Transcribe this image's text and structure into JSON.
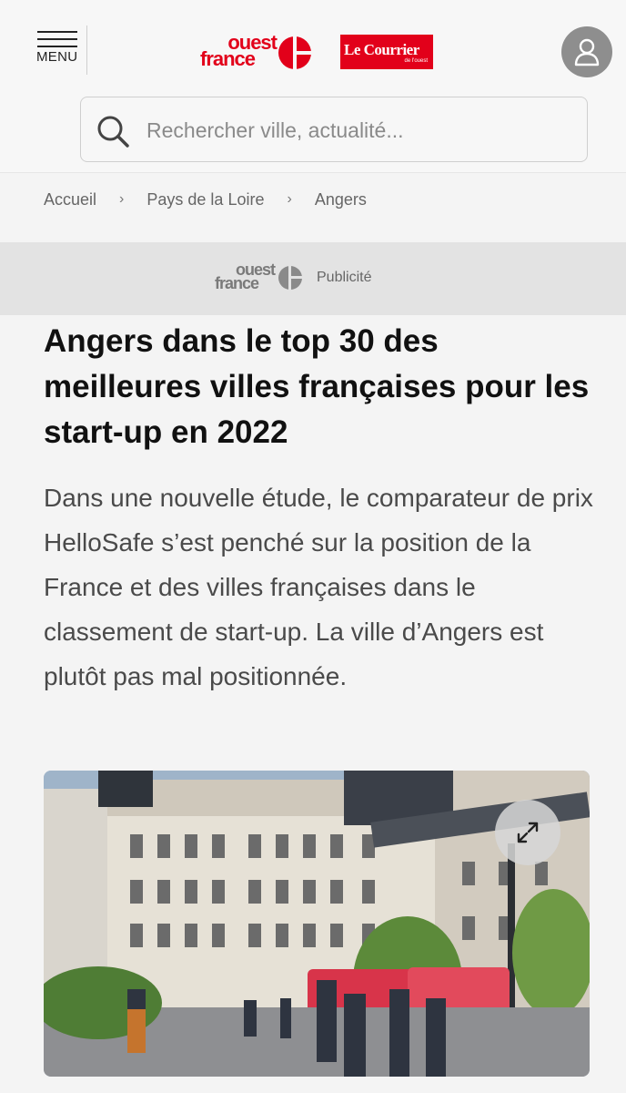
{
  "header": {
    "menu_label": "MENU",
    "logo_ouest_france": {
      "line1": "ouest",
      "line2": "france"
    },
    "logo_le_courrier": {
      "name": "Le Courrier",
      "sub": "de l'ouest"
    },
    "search": {
      "placeholder": "Rechercher ville, actualité..."
    }
  },
  "breadcrumb": [
    "Accueil",
    "Pays de la Loire",
    "Angers"
  ],
  "ad": {
    "label": "Publicité"
  },
  "article": {
    "title": "Angers dans le top 30 des meilleures villes françaises pour les start-up en 2022",
    "lede": "Dans une nouvelle étude, le comparateur de prix HelloSafe s’est penché sur la position de la France et des villes françaises dans le classement de start-up. La ville d’Angers est plutôt pas mal positionnée."
  },
  "colors": {
    "brand_red": "#e2001a",
    "ad_gray": "#e3e3e3"
  },
  "icons": [
    "menu-icon",
    "user-icon",
    "search-icon",
    "chevron-right-icon",
    "expand-icon"
  ]
}
